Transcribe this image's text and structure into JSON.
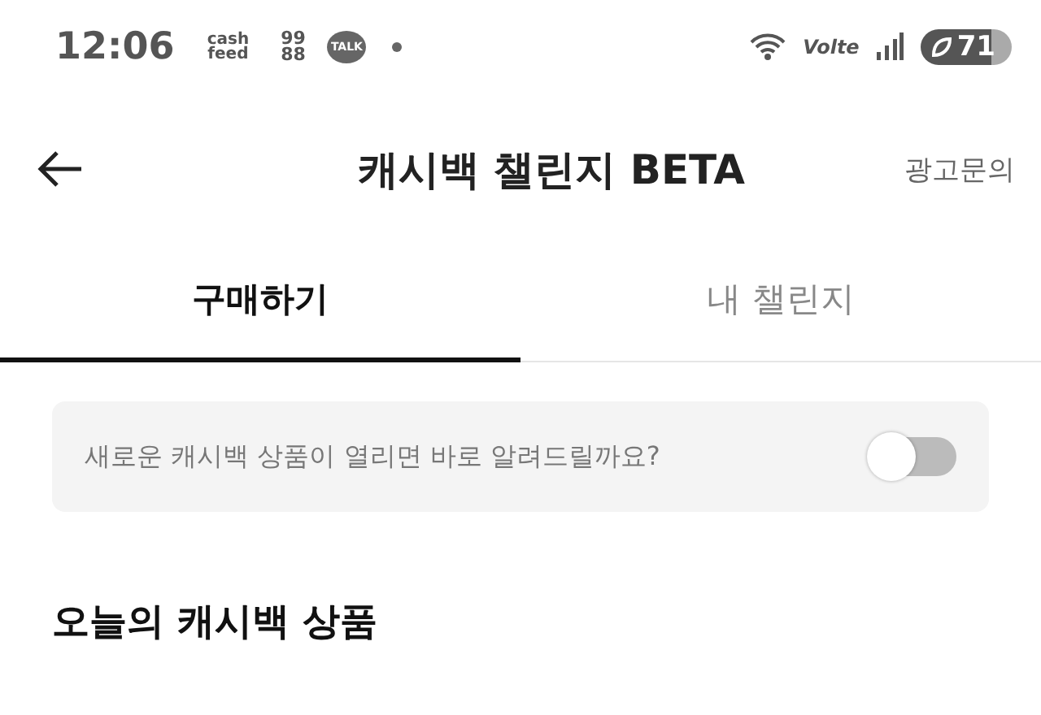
{
  "status_bar": {
    "time": "12:06",
    "app_icons": [
      {
        "kind": "text",
        "label": "cash feed"
      },
      {
        "kind": "text",
        "label": "99 88"
      },
      {
        "kind": "bubble",
        "label": "TALK"
      },
      {
        "kind": "dot"
      }
    ],
    "network": "Volte",
    "battery": "71"
  },
  "header": {
    "title": "캐시백 챌린지 BETA",
    "action": "광고문의"
  },
  "tabs": [
    {
      "label": "구매하기",
      "selected": true
    },
    {
      "label": "내 챌린지",
      "selected": false
    }
  ],
  "notice": {
    "text": "새로운 캐시백 상품이 열리면 바로 알려드릴까요?",
    "on": false
  },
  "section": {
    "title": "오늘의 캐시백 상품"
  }
}
